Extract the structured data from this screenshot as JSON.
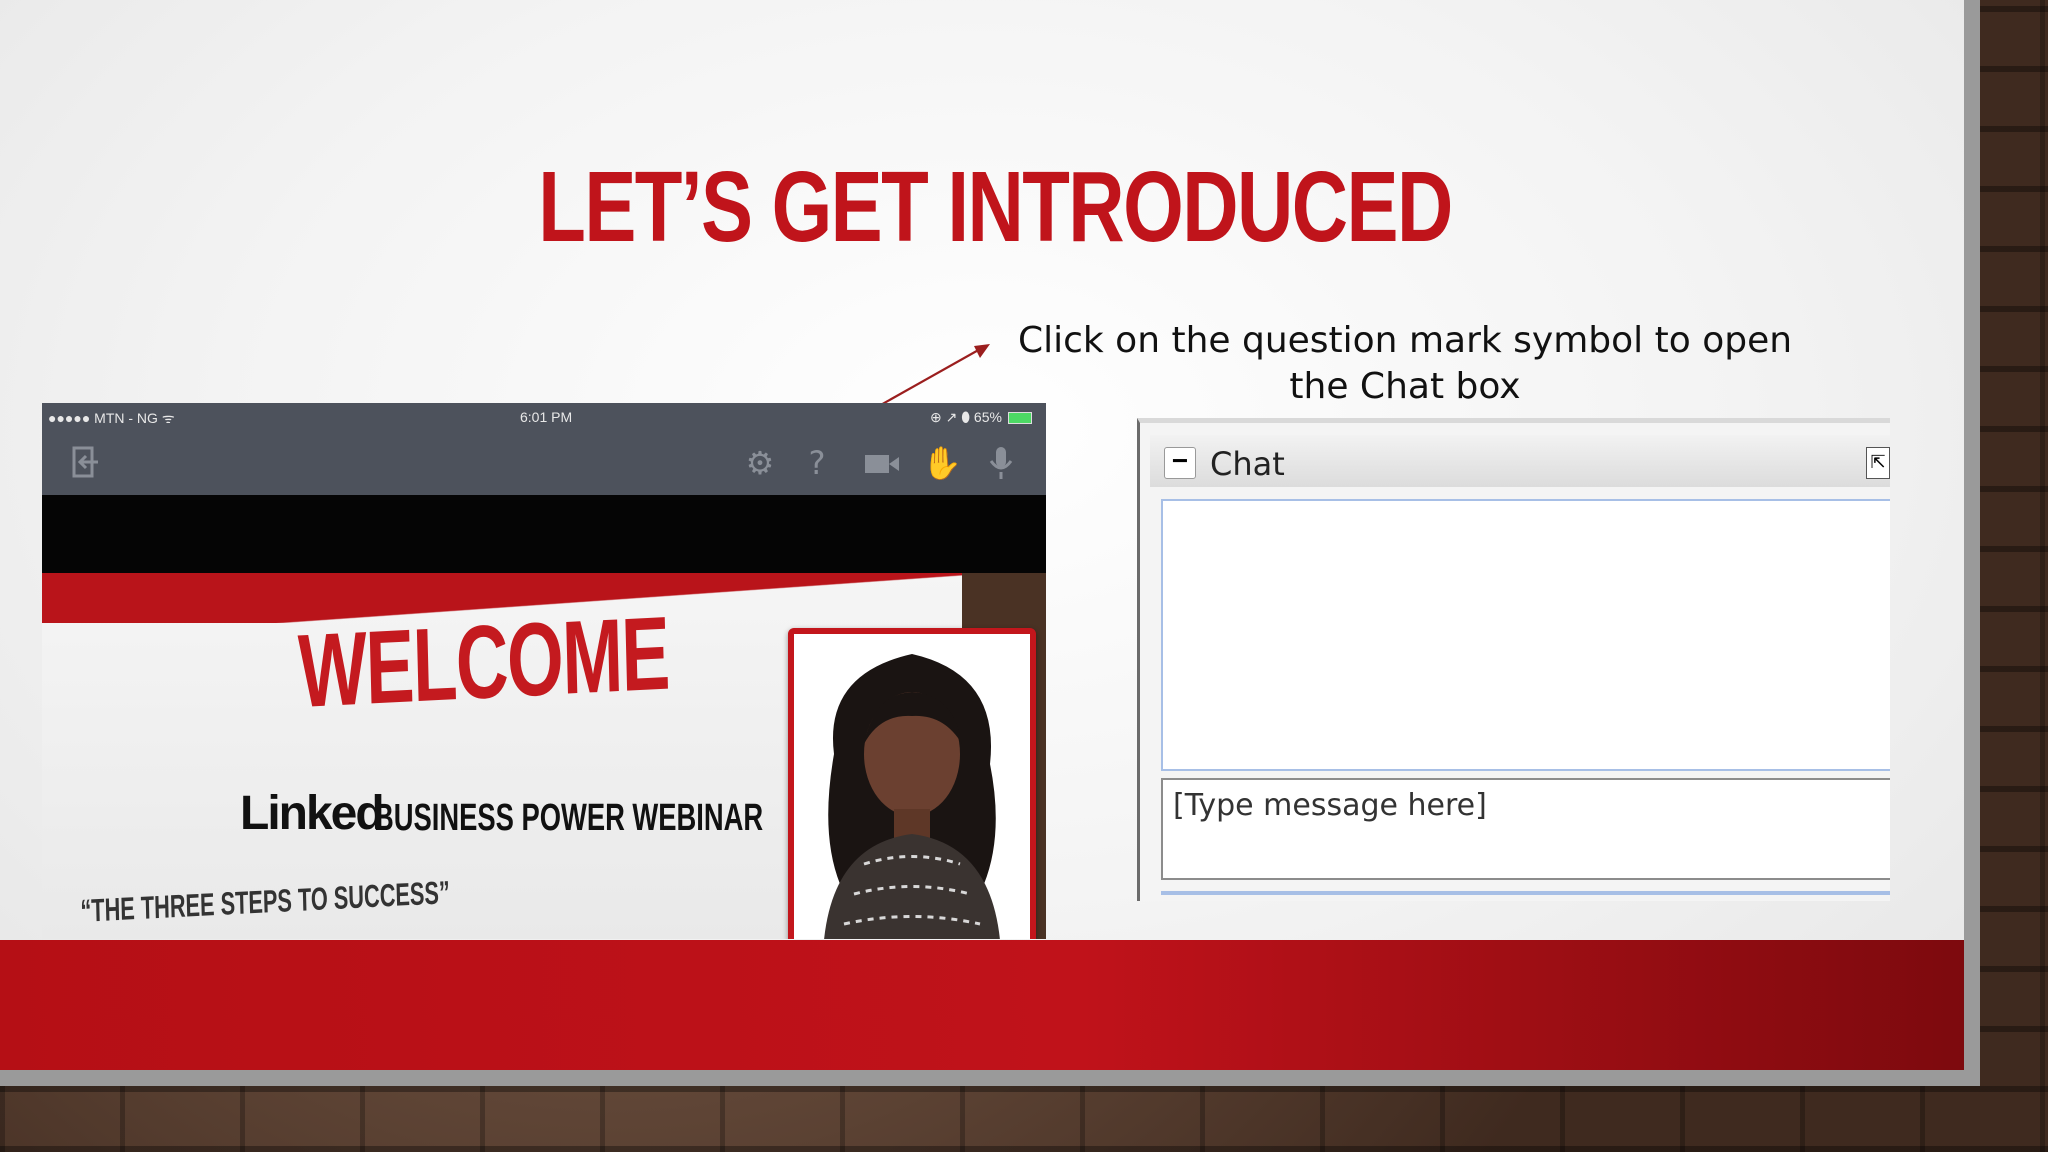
{
  "slide": {
    "title": "LET’S GET INTRODUCED",
    "instruction": "Click on the question mark symbol to open the Chat box"
  },
  "phone": {
    "carrier": "●●●●● MTN - NG ᯤ",
    "time": "6:01 PM",
    "status_right": "⊕ ↗ ⬮ 65%",
    "toolbar_icons": [
      "exit-icon",
      "gear-icon",
      "question-icon",
      "camera-icon",
      "hand-icon",
      "microphone-icon"
    ]
  },
  "webinar": {
    "welcome": "WELCOME",
    "brand": "Linked",
    "subtitle": "BUSINESS POWER WEBINAR",
    "tagline": "“THE THREE STEPS TO SUCCESS”"
  },
  "chat": {
    "collapse_label": "−",
    "title": "Chat",
    "popout_label": "⇱",
    "input_value": "[Type message here]"
  },
  "colors": {
    "accent_red": "#c0141b",
    "toolbar_gray": "#4d525c",
    "chat_border_blue": "#a7bfe6"
  }
}
